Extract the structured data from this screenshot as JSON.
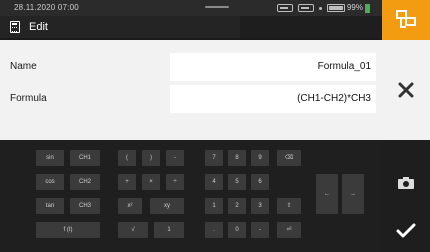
{
  "status": {
    "datetime": "28.11.2020  07:00",
    "battery_percent": "99%"
  },
  "titlebar": {
    "title": "Edit",
    "icon": "calculator-icon"
  },
  "form": {
    "name_label": "Name",
    "name_value": "Formula_01",
    "formula_label": "Formula",
    "formula_value": "(CH1-CH2)*CH3"
  },
  "keyboard": {
    "rows": [
      [
        "sin",
        "CH1",
        "(",
        ")",
        "-",
        "7",
        "8",
        "9",
        "⌫"
      ],
      [
        "cos",
        "CH2",
        "+",
        "×",
        "÷",
        "4",
        "5",
        "6",
        "←",
        "→"
      ],
      [
        "tan",
        "CH3",
        "x²",
        "xy",
        "1",
        "2",
        "3",
        "⇧"
      ],
      [
        "f (t)",
        "√",
        "1",
        ".",
        "0",
        "-",
        "⏎"
      ]
    ]
  },
  "sidebar": {
    "formula_icon": "formula-icon",
    "close_icon": "close-icon",
    "camera_icon": "camera-icon",
    "confirm_icon": "checkmark-icon"
  },
  "colors": {
    "accent": "#f39c12",
    "panel": "#f2f2f2",
    "dark": "#1e1e1e",
    "key": "#3b3b3b"
  }
}
